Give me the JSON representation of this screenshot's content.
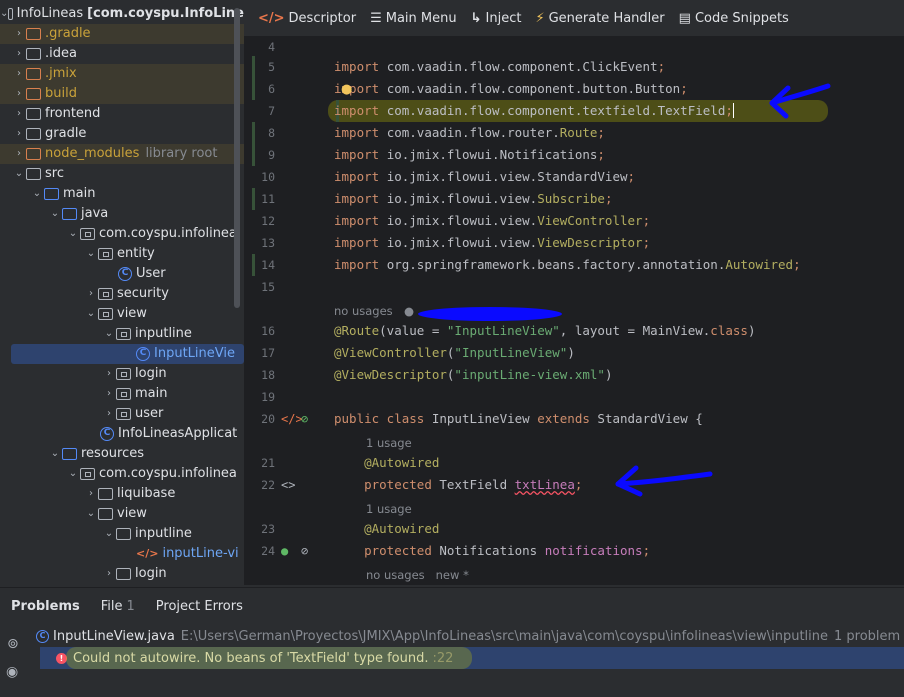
{
  "project_tree": {
    "items": [
      {
        "label": "InfoLineas",
        "extra": "[com.coyspu.InfoLine",
        "kind": "root"
      },
      {
        "label": ".gradle",
        "kind": "excluded"
      },
      {
        "label": ".idea",
        "kind": "folder"
      },
      {
        "label": ".jmix",
        "kind": "excluded"
      },
      {
        "label": "build",
        "kind": "excluded"
      },
      {
        "label": "frontend",
        "kind": "folder"
      },
      {
        "label": "gradle",
        "kind": "folder"
      },
      {
        "label": "node_modules",
        "extra": "library root",
        "kind": "excluded"
      },
      {
        "label": "src",
        "kind": "folder"
      },
      {
        "label": "main",
        "kind": "folder"
      },
      {
        "label": "java",
        "kind": "folder"
      },
      {
        "label": "com.coyspu.infolinea",
        "kind": "package"
      },
      {
        "label": "entity",
        "kind": "package"
      },
      {
        "label": "User",
        "kind": "class"
      },
      {
        "label": "security",
        "kind": "package"
      },
      {
        "label": "view",
        "kind": "package"
      },
      {
        "label": "inputline",
        "kind": "package"
      },
      {
        "label": "InputLineVie",
        "kind": "class-selected"
      },
      {
        "label": "login",
        "kind": "package"
      },
      {
        "label": "main",
        "kind": "package"
      },
      {
        "label": "user",
        "kind": "package"
      },
      {
        "label": "InfoLineasApplicat",
        "kind": "class"
      },
      {
        "label": "resources",
        "kind": "folder"
      },
      {
        "label": "com.coyspu.infolinea",
        "kind": "package"
      },
      {
        "label": "liquibase",
        "kind": "folder"
      },
      {
        "label": "view",
        "kind": "folder"
      },
      {
        "label": "inputline",
        "kind": "folder"
      },
      {
        "label": "inputLine-vi",
        "kind": "xml"
      },
      {
        "label": "login",
        "kind": "folder"
      }
    ]
  },
  "toolbar": {
    "descriptor": "Descriptor",
    "main_menu": "Main Menu",
    "inject": "Inject",
    "generate_handler": "Generate Handler",
    "code_snippets": "Code Snippets"
  },
  "editor": {
    "lines": [
      {
        "n": "4"
      },
      {
        "n": "5",
        "tokens": [
          [
            "k",
            "import "
          ],
          [
            "p",
            "com.vaadin.flow.component.ClickEvent"
          ],
          [
            "k",
            ";"
          ]
        ]
      },
      {
        "n": "6",
        "tokens": [
          [
            "k",
            "import "
          ],
          [
            "p",
            "com.vaadin.flow.component.button.Button"
          ],
          [
            "k",
            ";"
          ]
        ]
      },
      {
        "n": "7",
        "tokens": [
          [
            "k",
            "import "
          ],
          [
            "p",
            "com.vaadin.flow.component.textfield.TextField"
          ],
          [
            "k",
            ";"
          ]
        ]
      },
      {
        "n": "8",
        "tokens": [
          [
            "k",
            "import "
          ],
          [
            "p",
            "com.vaadin.flow.router."
          ],
          [
            "a",
            "Route"
          ],
          [
            "k",
            ";"
          ]
        ]
      },
      {
        "n": "9",
        "tokens": [
          [
            "k",
            "import "
          ],
          [
            "p",
            "io.jmix.flowui.Notifications"
          ],
          [
            "k",
            ";"
          ]
        ]
      },
      {
        "n": "10",
        "tokens": [
          [
            "k",
            "import "
          ],
          [
            "p",
            "io.jmix.flowui.view.StandardView"
          ],
          [
            "k",
            ";"
          ]
        ]
      },
      {
        "n": "11",
        "tokens": [
          [
            "k",
            "import "
          ],
          [
            "p",
            "io.jmix.flowui.view."
          ],
          [
            "a",
            "Subscribe"
          ],
          [
            "k",
            ";"
          ]
        ]
      },
      {
        "n": "12",
        "tokens": [
          [
            "k",
            "import "
          ],
          [
            "p",
            "io.jmix.flowui.view."
          ],
          [
            "a",
            "ViewController"
          ],
          [
            "k",
            ";"
          ]
        ]
      },
      {
        "n": "13",
        "tokens": [
          [
            "k",
            "import "
          ],
          [
            "p",
            "io.jmix.flowui.view."
          ],
          [
            "a",
            "ViewDescriptor"
          ],
          [
            "k",
            ";"
          ]
        ]
      },
      {
        "n": "14",
        "tokens": [
          [
            "k",
            "import "
          ],
          [
            "p",
            "org.springframework.beans.factory.annotation."
          ],
          [
            "a",
            "Autowired"
          ],
          [
            "k",
            ";"
          ]
        ]
      },
      {
        "n": "15"
      },
      {
        "hint": "no usages"
      },
      {
        "n": "16",
        "tokens": [
          [
            "a",
            "@Route"
          ],
          [
            "p",
            "(value = "
          ],
          [
            "s",
            "\"InputLineView\""
          ],
          [
            "p",
            ", layout = MainView."
          ],
          [
            "k",
            "class"
          ],
          [
            "p",
            ")"
          ]
        ]
      },
      {
        "n": "17",
        "tokens": [
          [
            "a",
            "@ViewController"
          ],
          [
            "p",
            "("
          ],
          [
            "s",
            "\"InputLineView\""
          ],
          [
            "p",
            ")"
          ]
        ]
      },
      {
        "n": "18",
        "tokens": [
          [
            "a",
            "@ViewDescriptor"
          ],
          [
            "p",
            "("
          ],
          [
            "s",
            "\"inputLine-view.xml\""
          ],
          [
            "p",
            ")"
          ]
        ]
      },
      {
        "n": "19"
      },
      {
        "n": "20",
        "tokens": [
          [
            "k",
            "public class "
          ],
          [
            "p",
            "InputLineView "
          ],
          [
            "k",
            "extends "
          ],
          [
            "p",
            "StandardView {"
          ]
        ]
      },
      {
        "hint": "1 usage"
      },
      {
        "n": "21",
        "tokens": [
          [
            "p",
            "    "
          ],
          [
            "a",
            "@Autowired"
          ]
        ]
      },
      {
        "n": "22",
        "tokens": [
          [
            "p",
            "    "
          ],
          [
            "k",
            "protected "
          ],
          [
            "p",
            "TextField "
          ],
          [
            "f",
            "txtLinea"
          ],
          [
            "k",
            ";"
          ]
        ]
      },
      {
        "hint": "1 usage"
      },
      {
        "n": "23",
        "tokens": [
          [
            "p",
            "    "
          ],
          [
            "a",
            "@Autowired"
          ]
        ]
      },
      {
        "n": "24",
        "tokens": [
          [
            "p",
            "    "
          ],
          [
            "k",
            "protected "
          ],
          [
            "p",
            "Notifications "
          ],
          [
            "f",
            "notifications"
          ],
          [
            "k",
            ";"
          ]
        ]
      },
      {
        "hint": "no usages   new *"
      }
    ]
  },
  "bottom_panel": {
    "tabs": [
      {
        "label": "Problems"
      },
      {
        "label": "File",
        "count": "1"
      },
      {
        "label": "Project Errors"
      }
    ],
    "file_name": "InputLineView.java",
    "file_path": "E:\\Users\\German\\Proyectos\\JMIX\\App\\InfoLineas\\src\\main\\java\\com\\coyspu\\infolineas\\view\\inputline",
    "problem_count": "1 problem",
    "message": "Could not autowire. No beans of 'TextField' type found.",
    "message_line": ":22"
  },
  "colors": {
    "background": "#1e1f22",
    "panel": "#2b2d30",
    "keyword": "#cf8e6d",
    "string": "#6aab73",
    "annotation": "#b3ae60",
    "field": "#c77dbb",
    "error": "#f75464",
    "selection": "#2e436e",
    "arrow": "#0a0aff"
  }
}
